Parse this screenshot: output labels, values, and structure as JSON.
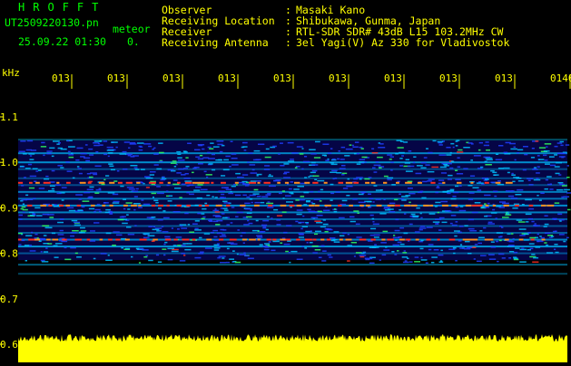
{
  "header": {
    "app_title": "HROFFT",
    "filename": "UT2509220130.pn",
    "mode": "meteor",
    "datetime": "25.09.22 01:30",
    "count": "0.",
    "info": [
      {
        "label": "Observer",
        "value": "Masaki Kano"
      },
      {
        "label": "Receiving Location",
        "value": "Shibukawa, Gunma, Japan"
      },
      {
        "label": "Receiver",
        "value": "RTL-SDR SDR# 43dB L15 103.2MHz CW"
      },
      {
        "label": "Receiving Antenna",
        "value": "3el Yagi(V) Az 330 for Vladivostok"
      }
    ]
  },
  "plot": {
    "unit_label": "kHz",
    "time_ticks": [
      "013",
      "013",
      "013",
      "013",
      "013",
      "013",
      "013",
      "013",
      "013",
      "0140"
    ],
    "freq_ticks": [
      "1.1",
      "1.0",
      "0.9",
      "0.8",
      "0.7",
      "0.6"
    ],
    "colors": {
      "background": "#000000",
      "spectrum_base": "#0a0a80",
      "signal_mid": "#00c0ff",
      "signal_high": "#30ff60",
      "signal_peak": "#ff3020",
      "baseline": "#ffff00",
      "text": "#ffff00"
    }
  }
}
